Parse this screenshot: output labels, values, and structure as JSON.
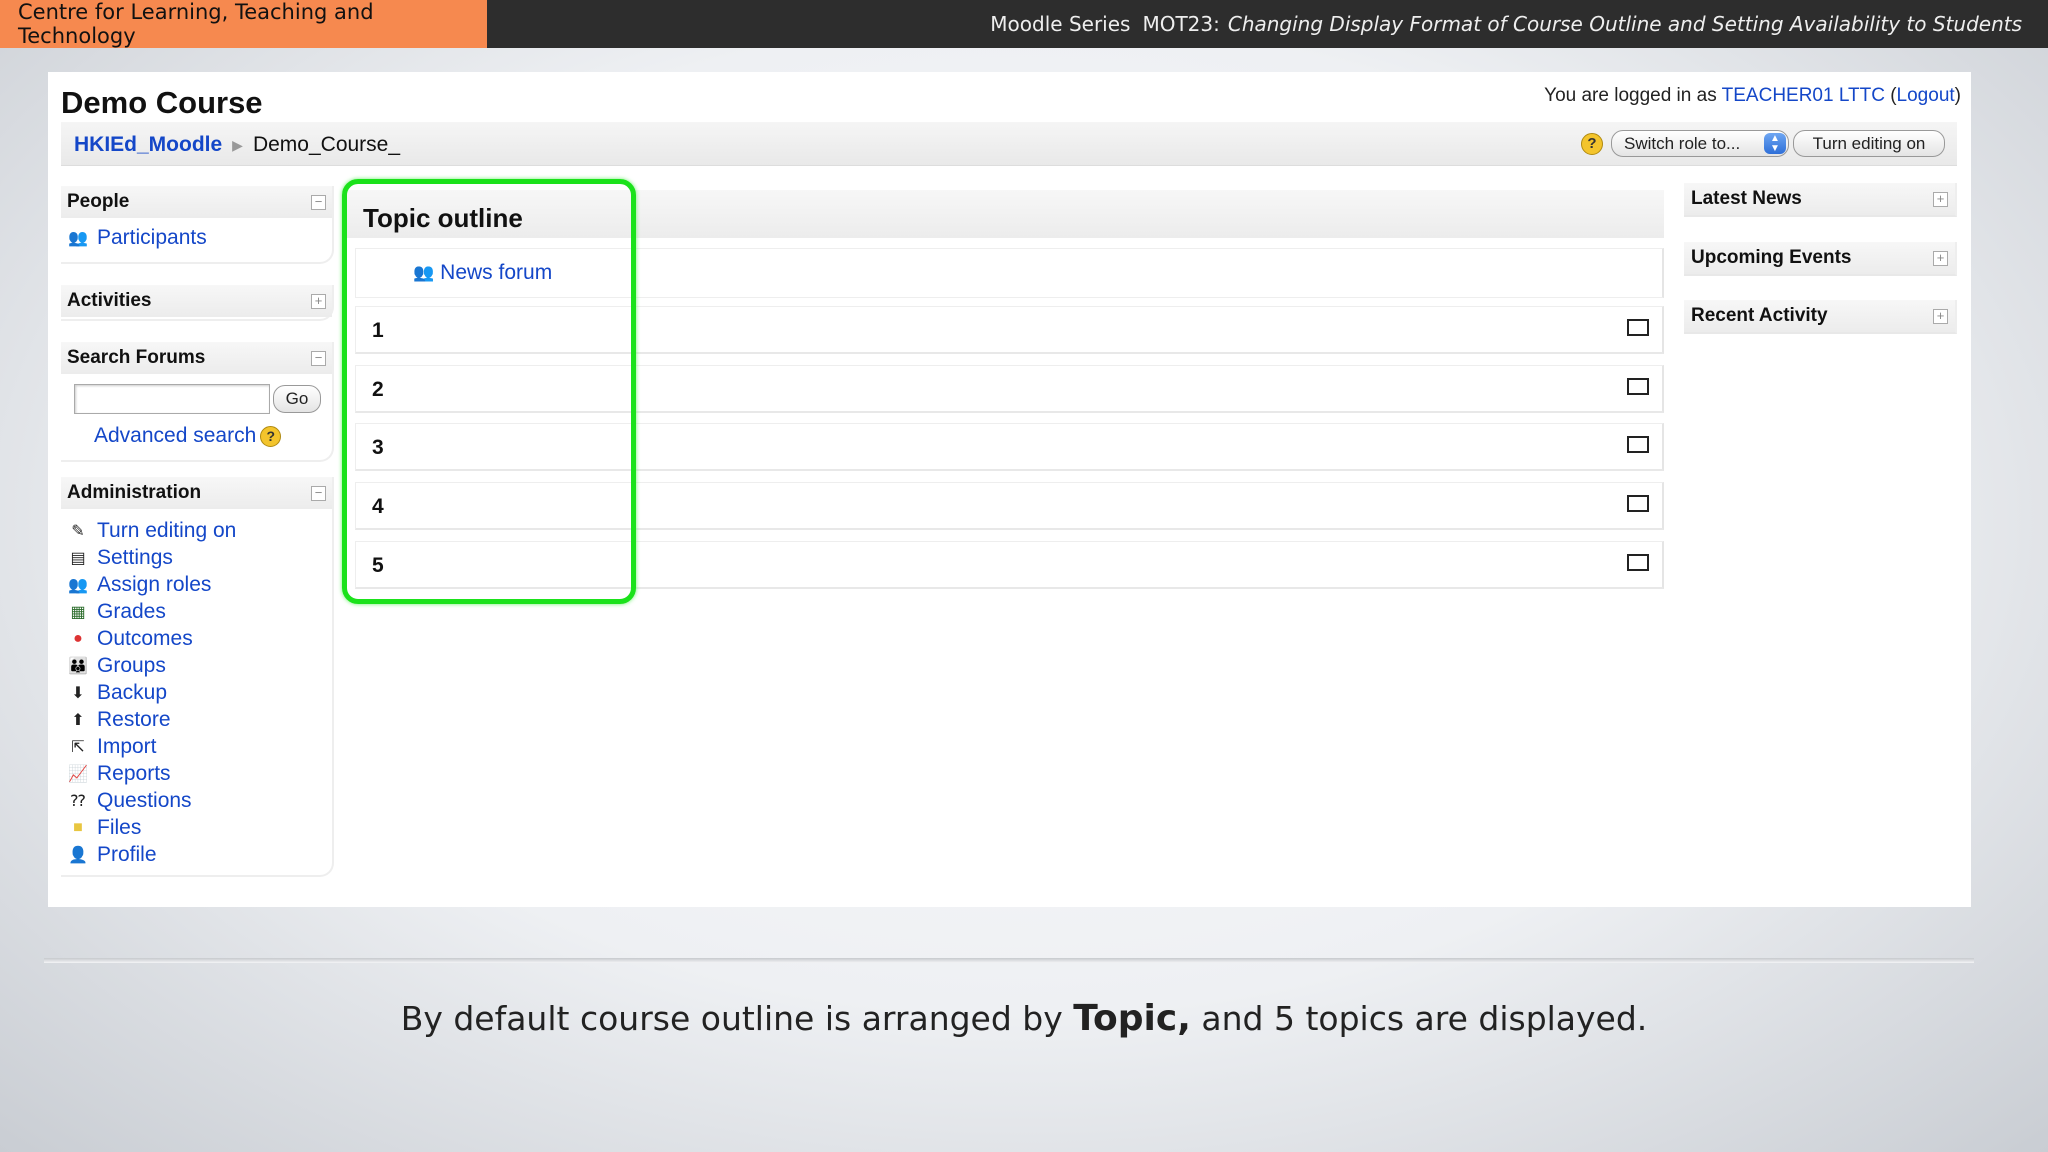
{
  "banner": {
    "org": "Centre for Learning, Teaching and Technology",
    "series": "Moodle Series",
    "code": "MOT23:",
    "lesson": "Changing Display Format of Course Outline and Setting Availability to Students"
  },
  "course": {
    "title": "Demo Course",
    "login_prefix": "You are logged in as",
    "user": "TEACHER01 LTTC",
    "paren_open": " (",
    "logout": "Logout",
    "paren_close": ")"
  },
  "breadcrumb": {
    "home": "HKIEd_Moodle",
    "sep": "▶",
    "current": "Demo_Course_"
  },
  "nav": {
    "help": "?",
    "switch_role": "Switch role to...",
    "turn_editing": "Turn editing on"
  },
  "blocks": {
    "people": {
      "title": "People",
      "toggle": "−",
      "items": [
        {
          "label": "Participants",
          "icon": "participants-icon"
        }
      ]
    },
    "activities": {
      "title": "Activities",
      "toggle": "+"
    },
    "search_forums": {
      "title": "Search Forums",
      "toggle": "−",
      "go": "Go",
      "advanced": "Advanced search",
      "help": "?"
    },
    "administration": {
      "title": "Administration",
      "toggle": "−",
      "items": [
        {
          "label": "Turn editing on",
          "icon": "edit-icon"
        },
        {
          "label": "Settings",
          "icon": "settings-icon"
        },
        {
          "label": "Assign roles",
          "icon": "roles-icon"
        },
        {
          "label": "Grades",
          "icon": "grades-icon"
        },
        {
          "label": "Outcomes",
          "icon": "outcomes-icon"
        },
        {
          "label": "Groups",
          "icon": "groups-icon"
        },
        {
          "label": "Backup",
          "icon": "backup-icon"
        },
        {
          "label": "Restore",
          "icon": "restore-icon"
        },
        {
          "label": "Import",
          "icon": "import-icon"
        },
        {
          "label": "Reports",
          "icon": "reports-icon"
        },
        {
          "label": "Questions",
          "icon": "questions-icon"
        },
        {
          "label": "Files",
          "icon": "folder-icon"
        },
        {
          "label": "Profile",
          "icon": "profile-icon"
        }
      ]
    }
  },
  "outline": {
    "title": "Topic outline",
    "news_forum": "News forum",
    "sections": [
      "1",
      "2",
      "3",
      "4",
      "5"
    ]
  },
  "right_blocks": [
    {
      "title": "Latest News",
      "toggle": "+"
    },
    {
      "title": "Upcoming Events",
      "toggle": "+"
    },
    {
      "title": "Recent Activity",
      "toggle": "+"
    }
  ],
  "caption": {
    "before": "By default course outline is arranged by ",
    "bold": "Topic,",
    "after": " and 5 topics are displayed."
  },
  "colors": {
    "banner_accent": "#f6894f",
    "link": "#1447c8",
    "highlight": "#1be21b"
  }
}
